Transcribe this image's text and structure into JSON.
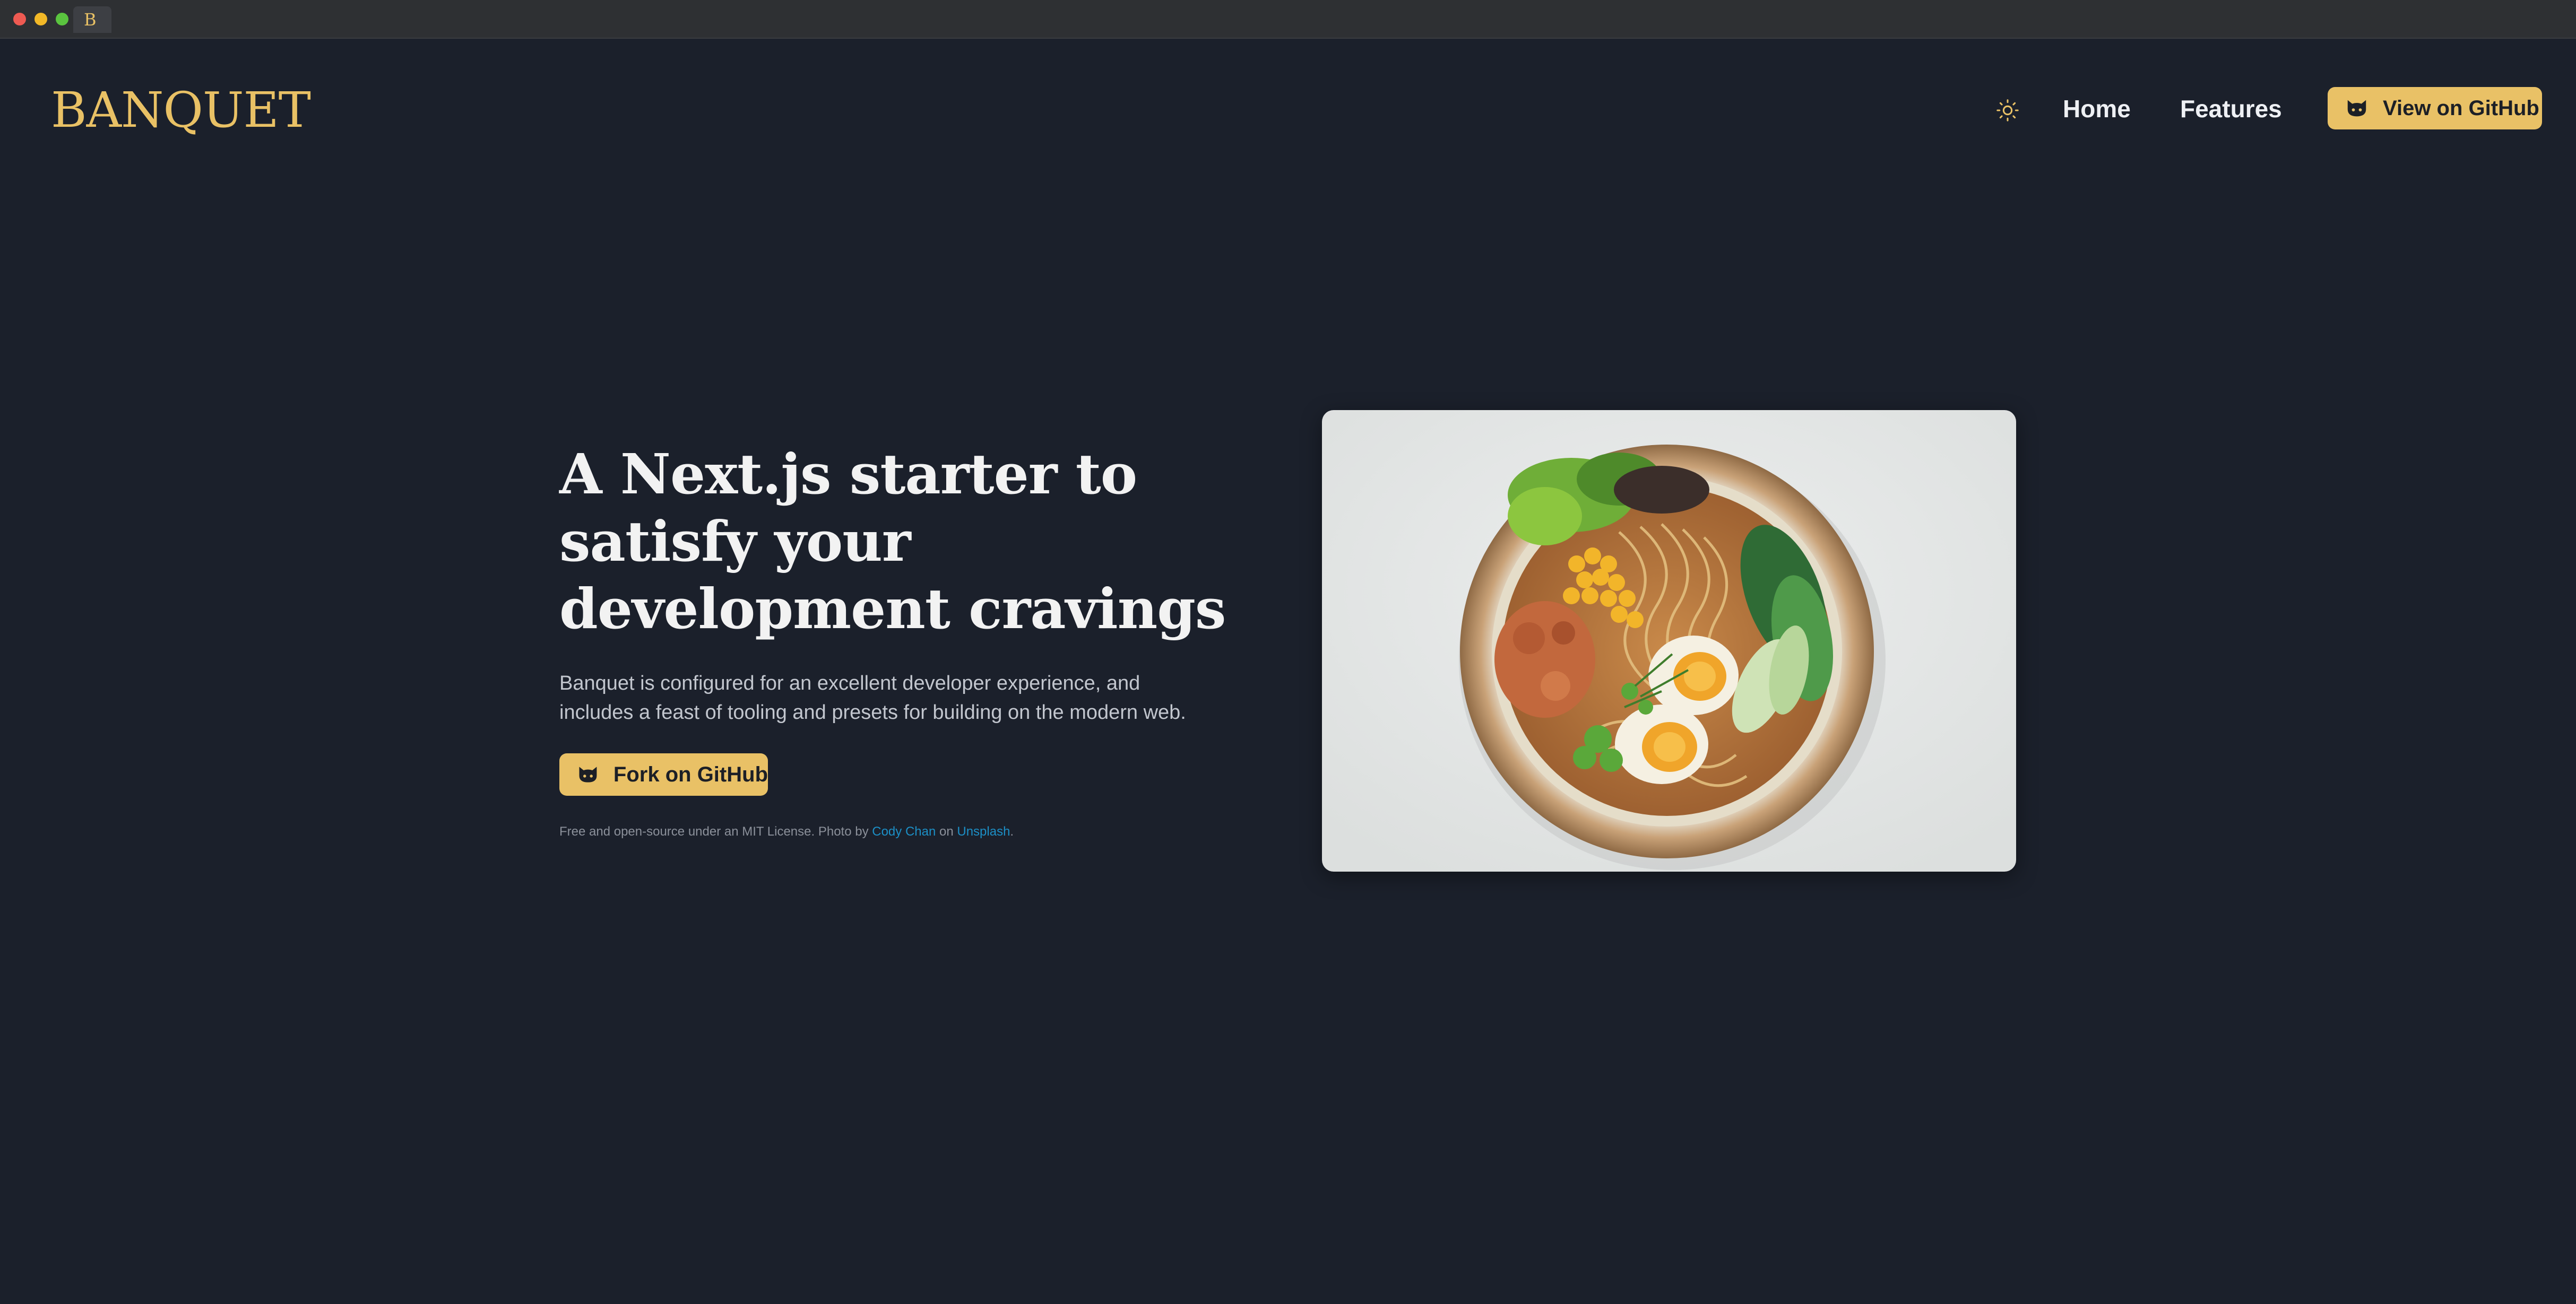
{
  "browser": {
    "tab_favicon": "B"
  },
  "header": {
    "logo": "BANQUET",
    "theme_toggle_icon": "sun-icon",
    "nav": [
      {
        "label": "Home"
      },
      {
        "label": "Features"
      }
    ],
    "github_button": {
      "label": "View on GitHub",
      "icon": "github-icon"
    }
  },
  "hero": {
    "title": "A Next.js starter to satisfy your development cravings",
    "description": "Banquet is configured for an excellent developer experience, and includes a feast of tooling and presets for building on the modern web.",
    "fork_button": {
      "label": "Fork on GitHub",
      "icon": "github-icon"
    },
    "license": {
      "prefix": "Free and open-source under an MIT License. Photo by ",
      "author_link": "Cody Chan",
      "middle": " on ",
      "source_link": "Unsplash",
      "suffix": "."
    },
    "image_subject": "ramen-bowl-photo"
  },
  "colors": {
    "background": "#1b202b",
    "accent": "#e9c166",
    "link": "#1c8fc6",
    "text": "#f2f2f2"
  }
}
